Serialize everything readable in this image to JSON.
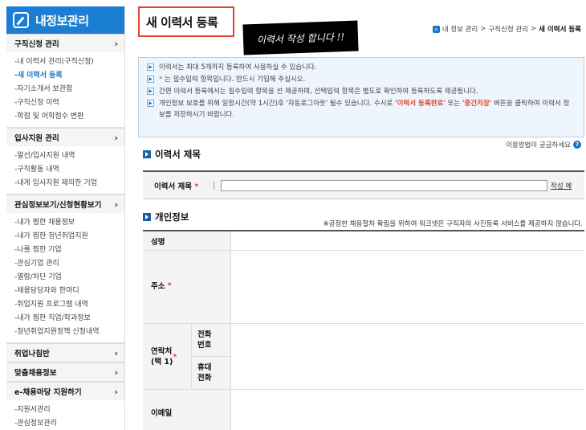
{
  "sidebar": {
    "title": "내정보관리",
    "sections": [
      {
        "head": "구직신청 관리",
        "items": [
          "-내 이력서 관리(구직신청)",
          "-새 이력서 등록",
          "-자기소개서 보관함",
          "-구직신청 이력",
          "-학점 및 어학점수 변환"
        ],
        "active": 1
      },
      {
        "head": "입사지원 관리",
        "items": [
          "-알선/입사지원 내역",
          "-구직활동 내역",
          "-내게 입사지원 제의한 기업"
        ]
      },
      {
        "head": "관심정보보기/신청현황보기",
        "items": [
          "-내가 찜한 채용정보",
          "-내가 찜한 청년취업지원",
          "-나를 찜한 기업",
          "-관심기업 관리",
          "-열람/차단 기업",
          "-채용담당자와 한마디",
          "-취업지원 프로그램 내역",
          "-내가 찜한 직업/학과정보",
          "-청년취업지원정책 신청내역"
        ]
      },
      {
        "head": "취업나침반",
        "items": []
      },
      {
        "head": "맞춤채용정보",
        "items": []
      },
      {
        "head": "e-채용마당 지원하기",
        "items": [
          "-지원서관리",
          "-관심정보관리"
        ]
      }
    ]
  },
  "page_title": "새 이력서 등록",
  "sticker": "이력서 작성 합니다 !!",
  "breadcrumb": [
    "내 정보 관리",
    ">",
    "구직신청 관리",
    ">",
    "새 이력서 등록"
  ],
  "notices": {
    "n1": "이력서는 최대 5개까지 등록하여 사용하실 수 있습니다.",
    "n2_star": "*",
    "n2": "는 필수입력 항목입니다. 반드시 기입해 주십시오.",
    "n3": "간편 이력서 등록에서는 필수입력 항목을 선 제공하며, 선택입력 항목은 별도로 확인하여 등록하도록 제공됩니다.",
    "n4_a": "개인정보 보호를 위해 일정시간(약 1시간)후 '자동로그아웃' 될수 있습니다. 수시로",
    "n4_hl1": "'이력서 등록완료'",
    "n4_b": "또는",
    "n4_hl2": "'중간저장'",
    "n4_c": "버튼을 클릭하여 이력서 정보를 저장하시기 바랍니다."
  },
  "help_link": "이용방법이 궁금하세요",
  "help_icon": "?",
  "resume_title_section": {
    "heading": "이력서 제목",
    "label": "이력서 제목",
    "required": "*",
    "value": "",
    "example": "작성 예"
  },
  "personal_section": {
    "heading": "개인정보",
    "note": "※공정한 채용절차 확립을 위하여 워크넷은 구직자의 사진등록 서비스를 제공하지 않습니다.",
    "name_label": "성명",
    "address_label": "주소",
    "address_required": "*",
    "contact_label": "연락처\n(택 1)",
    "contact_required": "*",
    "phone_label": "전화\n번호",
    "mobile_label": "휴대\n전화",
    "email_label": "이메일"
  },
  "colors": {
    "brand_blue": "#1a7ed3",
    "highlight_red": "#e0462b",
    "notice_bg": "#eef5fc"
  }
}
